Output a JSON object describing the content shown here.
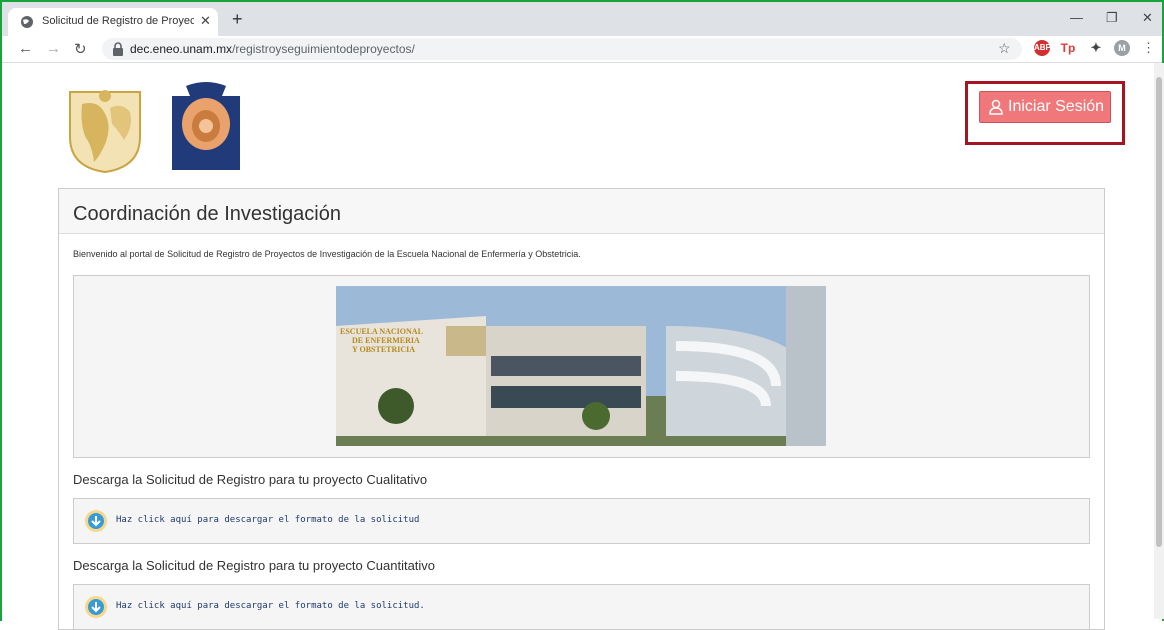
{
  "browser": {
    "tab_title": "Solicitud de Registro de Proyecto",
    "url_host": "dec.eneo.unam.mx",
    "url_path": "/registroyseguimientodeproyectos/",
    "profile_initial": "M"
  },
  "header": {
    "login_label": "Iniciar Sesión",
    "login_color": "#f0787a",
    "highlight_color": "#a31521"
  },
  "panel": {
    "title": "Coordinación de Investigación",
    "welcome": "Bienvenido al portal de Solicitud de Registro de Proyectos de Investigación de la Escuela Nacional de Enfermería y Obstetricia.",
    "downloads": [
      {
        "label": "Descarga la Solicitud de Registro para tu proyecto Cualitativo",
        "link": "Haz click aquí para descargar el formato de la solicitud"
      },
      {
        "label": "Descarga la Solicitud de Registro para tu proyecto Cuantitativo",
        "link": "Haz click aquí para descargar el formato de la solicitud."
      }
    ]
  },
  "photo": {
    "sign_lines": [
      "ESCUELA NACIONAL",
      "DE ENFERMERIA",
      "Y OBSTETRICIA"
    ]
  },
  "icons": [
    "globe-icon",
    "lock-icon",
    "star-icon",
    "user-icon",
    "download-arrow-icon"
  ]
}
